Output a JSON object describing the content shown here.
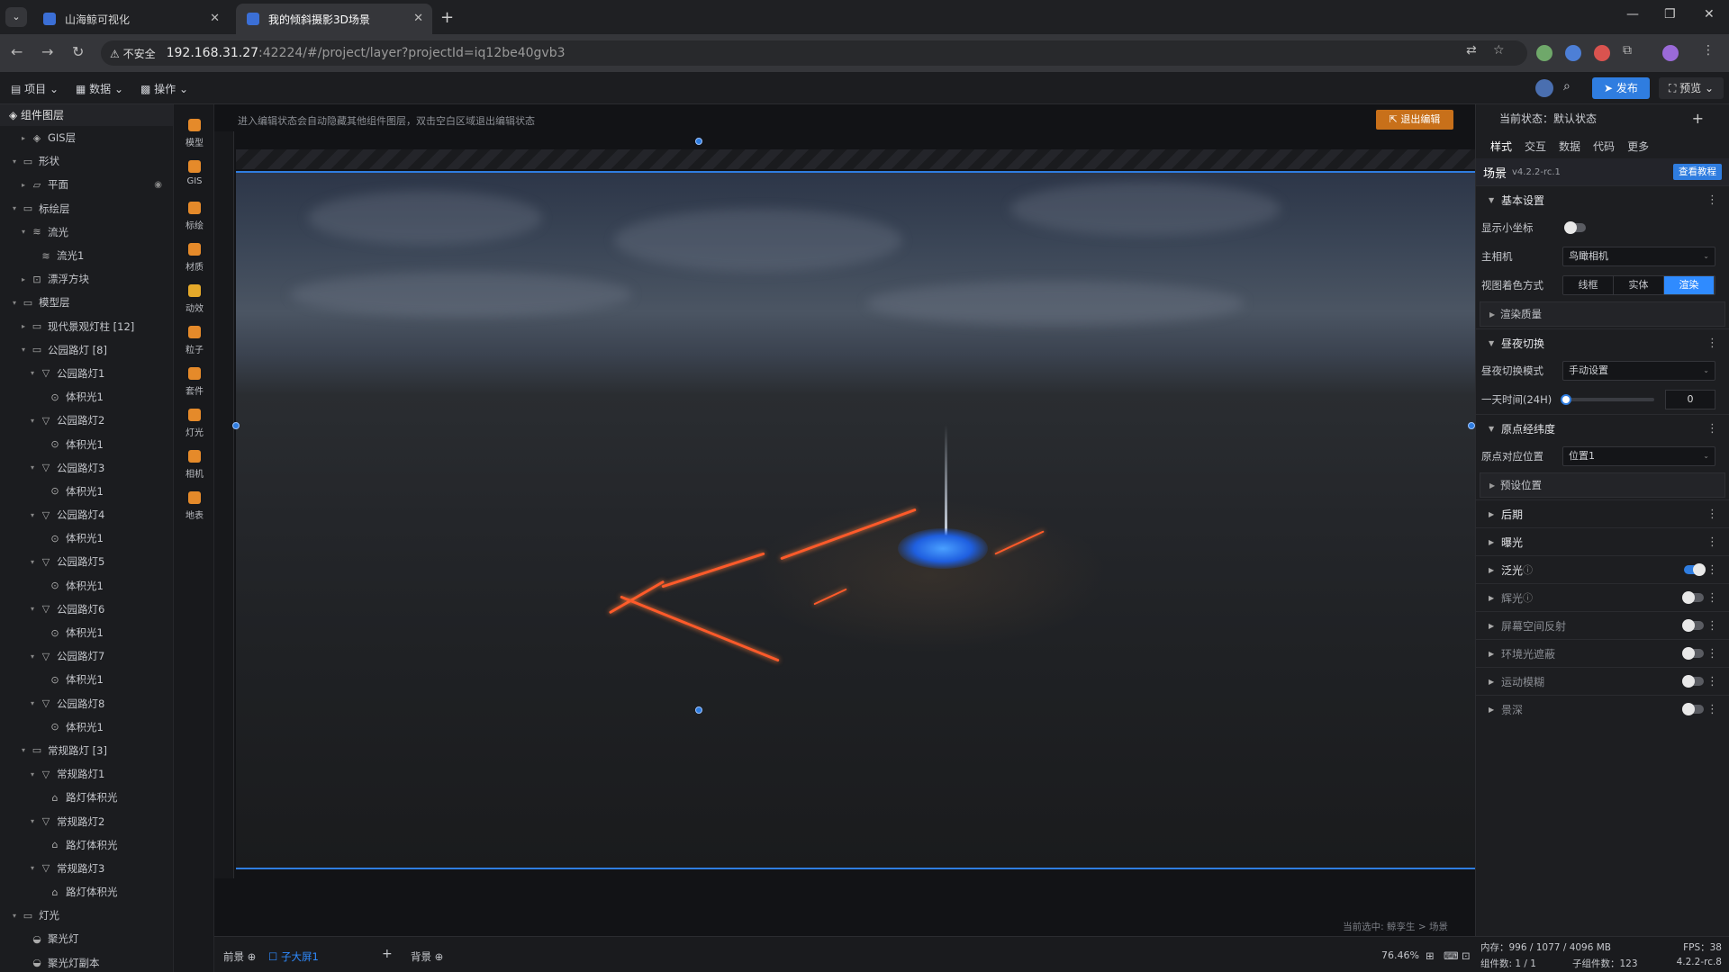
{
  "browser": {
    "tabs": [
      {
        "title": "山海鲸可视化"
      },
      {
        "title": "我的倾斜摄影3D场景"
      }
    ],
    "insecure_label": "不安全",
    "url_host": "192.168.31.27",
    "url_rest": ":42224/#/project/layer?projectId=iq12be40gvb3"
  },
  "app_menu": {
    "project": "项目",
    "data": "数据",
    "ops": "操作",
    "publish": "发布",
    "preview": "预览"
  },
  "layers": {
    "title": "组件图层",
    "rows": [
      {
        "label": "GIS层",
        "level": 1,
        "icon": "layer-icon",
        "arrow": "▸"
      },
      {
        "label": "形状",
        "level": 0,
        "icon": "folder-icon",
        "arrow": "▾"
      },
      {
        "label": "平面",
        "level": 1,
        "icon": "plane-icon",
        "arrow": "▸",
        "eye": true
      },
      {
        "label": "标绘层",
        "level": 0,
        "icon": "folder-icon",
        "arrow": "▾"
      },
      {
        "label": "流光",
        "level": 1,
        "icon": "flow-icon",
        "arrow": "▾"
      },
      {
        "label": "流光1",
        "level": 2,
        "icon": "flow-icon",
        "arrow": ""
      },
      {
        "label": "漂浮方块",
        "level": 1,
        "icon": "block-icon",
        "arrow": "▸"
      },
      {
        "label": "模型层",
        "level": 0,
        "icon": "folder-icon",
        "arrow": "▾"
      },
      {
        "label": "现代景观灯柱 [12]",
        "level": 1,
        "icon": "folder-icon",
        "arrow": "▸"
      },
      {
        "label": "公园路灯 [8]",
        "level": 1,
        "icon": "folder-icon",
        "arrow": "▾"
      },
      {
        "label": "公园路灯1",
        "level": 2,
        "icon": "cone-icon",
        "arrow": "▾"
      },
      {
        "label": "体积光1",
        "level": 3,
        "icon": "light-icon",
        "arrow": ""
      },
      {
        "label": "公园路灯2",
        "level": 2,
        "icon": "cone-icon",
        "arrow": "▾"
      },
      {
        "label": "体积光1",
        "level": 3,
        "icon": "light-icon",
        "arrow": ""
      },
      {
        "label": "公园路灯3",
        "level": 2,
        "icon": "cone-icon",
        "arrow": "▾"
      },
      {
        "label": "体积光1",
        "level": 3,
        "icon": "light-icon",
        "arrow": ""
      },
      {
        "label": "公园路灯4",
        "level": 2,
        "icon": "cone-icon",
        "arrow": "▾"
      },
      {
        "label": "体积光1",
        "level": 3,
        "icon": "light-icon",
        "arrow": ""
      },
      {
        "label": "公园路灯5",
        "level": 2,
        "icon": "cone-icon",
        "arrow": "▾"
      },
      {
        "label": "体积光1",
        "level": 3,
        "icon": "light-icon",
        "arrow": ""
      },
      {
        "label": "公园路灯6",
        "level": 2,
        "icon": "cone-icon",
        "arrow": "▾"
      },
      {
        "label": "体积光1",
        "level": 3,
        "icon": "light-icon",
        "arrow": ""
      },
      {
        "label": "公园路灯7",
        "level": 2,
        "icon": "cone-icon",
        "arrow": "▾"
      },
      {
        "label": "体积光1",
        "level": 3,
        "icon": "light-icon",
        "arrow": ""
      },
      {
        "label": "公园路灯8",
        "level": 2,
        "icon": "cone-icon",
        "arrow": "▾"
      },
      {
        "label": "体积光1",
        "level": 3,
        "icon": "light-icon",
        "arrow": ""
      },
      {
        "label": "常规路灯 [3]",
        "level": 1,
        "icon": "folder-icon",
        "arrow": "▾"
      },
      {
        "label": "常规路灯1",
        "level": 2,
        "icon": "cone-icon",
        "arrow": "▾"
      },
      {
        "label": "路灯体积光",
        "level": 3,
        "icon": "lamp-icon",
        "arrow": ""
      },
      {
        "label": "常规路灯2",
        "level": 2,
        "icon": "cone-icon",
        "arrow": "▾"
      },
      {
        "label": "路灯体积光",
        "level": 3,
        "icon": "lamp-icon",
        "arrow": ""
      },
      {
        "label": "常规路灯3",
        "level": 2,
        "icon": "cone-icon",
        "arrow": "▾"
      },
      {
        "label": "路灯体积光",
        "level": 3,
        "icon": "lamp-icon",
        "arrow": ""
      },
      {
        "label": "灯光",
        "level": 0,
        "icon": "folder-icon",
        "arrow": "▾"
      },
      {
        "label": "聚光灯",
        "level": 1,
        "icon": "spot-icon",
        "arrow": ""
      },
      {
        "label": "聚光灯副本",
        "level": 1,
        "icon": "spot-icon",
        "arrow": ""
      }
    ]
  },
  "rail": [
    {
      "label": "模型",
      "color": "#e58a2a"
    },
    {
      "label": "GIS",
      "color": "#e58a2a"
    },
    {
      "label": "标绘",
      "color": "#e58a2a"
    },
    {
      "label": "材质",
      "color": "#e58a2a"
    },
    {
      "label": "动效",
      "color": "#e5a92a"
    },
    {
      "label": "粒子",
      "color": "#e58a2a"
    },
    {
      "label": "套件",
      "color": "#e58a2a"
    },
    {
      "label": "灯光",
      "color": "#e58a2a"
    },
    {
      "label": "相机",
      "color": "#e58a2a"
    },
    {
      "label": "地表",
      "color": "#e58a2a"
    }
  ],
  "stage": {
    "hint": "进入编辑状态会自动隐藏其他组件图层，双击空白区域退出编辑状态",
    "exit_label": "退出编辑",
    "selection_path": "当前选中: 鲸孪生 > 场景"
  },
  "bottom": {
    "front_label": "前景",
    "screen_label": "子大屏1",
    "back_label": "背景",
    "zoom": "76.46%"
  },
  "props": {
    "state_label": "当前状态：默认状态",
    "tabs": [
      "样式",
      "交互",
      "数据",
      "代码",
      "更多"
    ],
    "scene_name": "场景",
    "scene_version": "v4.2.2-rc.1",
    "tutorial_label": "查看教程",
    "basic": {
      "title": "基本设置",
      "show_axis": "显示小坐标",
      "main_camera": "主相机",
      "main_camera_value": "鸟瞰相机",
      "shading_mode": "视图着色方式",
      "shading_options": [
        "线框",
        "实体",
        "渲染"
      ],
      "shading_selected": 2,
      "render_quality": "渲染质量"
    },
    "daynight": {
      "title": "昼夜切换",
      "mode_label": "昼夜切换模式",
      "mode_value": "手动设置",
      "time_label": "一天时间(24H)",
      "time_value": "0",
      "time_fraction": 0
    },
    "origin": {
      "title": "原点经纬度",
      "pos_label": "原点对应位置",
      "pos_value": "位置1",
      "preset": "预设位置"
    },
    "sections": [
      {
        "label": "后期",
        "dim": false,
        "toggle": null
      },
      {
        "label": "曝光",
        "dim": false,
        "toggle": null
      },
      {
        "label": "泛光",
        "dim": false,
        "toggle": true,
        "help": true
      },
      {
        "label": "辉光",
        "dim": true,
        "toggle": false,
        "help": true
      },
      {
        "label": "屏幕空间反射",
        "dim": true,
        "toggle": false
      },
      {
        "label": "环境光遮蔽",
        "dim": true,
        "toggle": false
      },
      {
        "label": "运动模糊",
        "dim": true,
        "toggle": false
      },
      {
        "label": "景深",
        "dim": true,
        "toggle": false
      }
    ]
  },
  "status": {
    "memory": "内存：996 / 1077 / 4096 MB",
    "fps": "FPS：38",
    "components": "组件数: 1 / 1",
    "sub_components": "子组件数：123",
    "version": "4.2.2-rc.8"
  }
}
